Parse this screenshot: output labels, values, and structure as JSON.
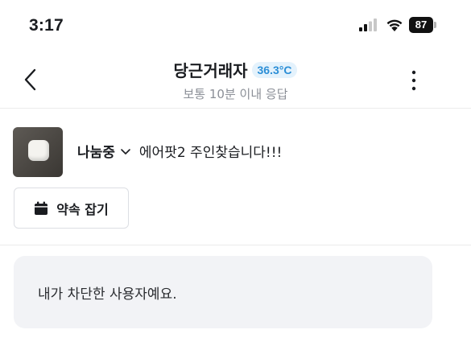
{
  "status_bar": {
    "time": "3:17",
    "battery": "87",
    "icons": [
      "signal-icon",
      "wifi-icon",
      "battery-icon"
    ]
  },
  "header": {
    "title": "당근거래자",
    "temperature": "36.3°C",
    "subtitle": "보통 10분 이내 응답",
    "back_icon": "chevron-left-icon",
    "more_icon": "more-vertical-icon"
  },
  "product": {
    "status": "나눔중",
    "title": "에어팟2 주인찾습니다!!!",
    "thumbnail_icon": "product-thumbnail",
    "appointment_label": "약속 잡기",
    "appointment_icon": "calendar-icon"
  },
  "chat": {
    "notice": "내가 차단한 사용자예요."
  },
  "colors": {
    "badge_bg": "#e4f2fc",
    "badge_text": "#2b8ed6",
    "notice_bg": "#f2f3f6"
  }
}
